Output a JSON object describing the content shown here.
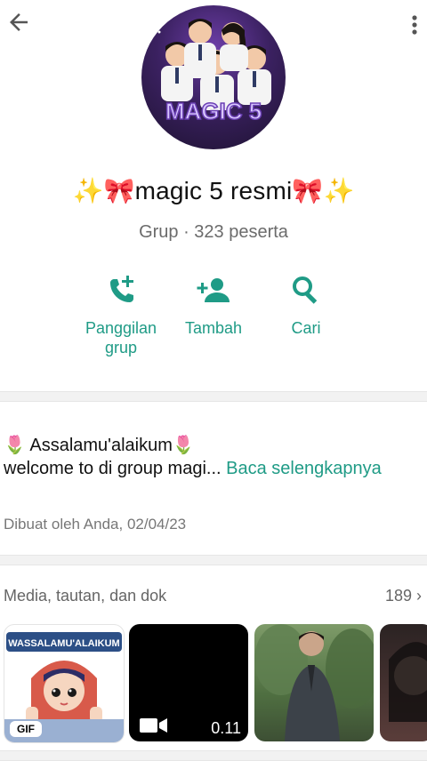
{
  "group": {
    "name": "✨🎀magic 5 resmi🎀✨",
    "meta": "Grup · 323 peserta",
    "avatar_text": "MAGIC 5"
  },
  "actions": [
    {
      "label": "Panggilan\ngrup"
    },
    {
      "label": "Tambah"
    },
    {
      "label": "Cari"
    }
  ],
  "description": {
    "text": "🌷 Assalamu'alaikum🌷\nwelcome to di group magi... ",
    "more": "Baca selengkapnya",
    "created": "Dibuat oleh Anda, 02/04/23"
  },
  "media": {
    "title": "Media, tautan, dan dok",
    "count": "189 ›",
    "sticker_text": "WASSALAMU'ALAIKUM",
    "gif_label": "GIF",
    "video_duration": "0.11"
  },
  "colors": {
    "accent": "#1f9b86",
    "muted": "#6b6b6b"
  },
  "icons": [
    "back-arrow-icon",
    "more-vert-icon",
    "call-add-icon",
    "person-add-icon",
    "search-icon",
    "video-icon"
  ]
}
